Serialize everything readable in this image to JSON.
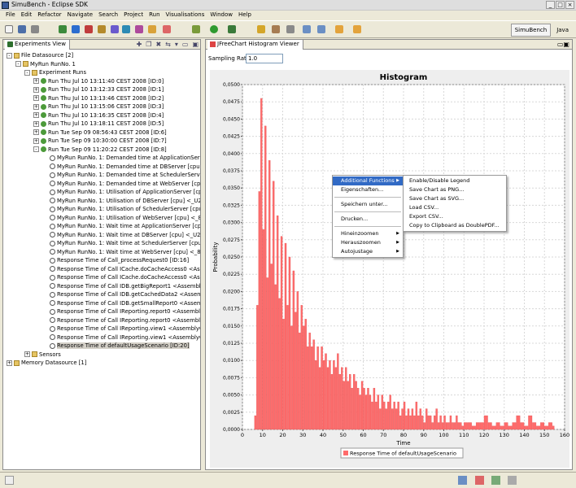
{
  "window": {
    "title": "SimuBench - Eclipse SDK",
    "controls": [
      "_",
      "□",
      "×"
    ]
  },
  "menubar": [
    "File",
    "Edit",
    "Refactor",
    "Navigate",
    "Search",
    "Project",
    "Run",
    "Visualisations",
    "Window",
    "Help"
  ],
  "perspectives": [
    {
      "label": "SimuBench",
      "active": true
    },
    {
      "label": "Java",
      "active": false
    }
  ],
  "experiments_view": {
    "tab": "Experiments View",
    "tree": [
      {
        "level": 0,
        "exp": "-",
        "icon": "folder",
        "text": "File Datasource [2]"
      },
      {
        "level": 1,
        "exp": "-",
        "icon": "folder",
        "text": "MyRun RunNo. 1"
      },
      {
        "level": 2,
        "exp": "-",
        "icon": "folder",
        "text": "Experiment Runs"
      },
      {
        "level": 3,
        "exp": "+",
        "icon": "run",
        "text": "Run Thu Jul 10 13:11:40 CEST 2008 [ID:0]"
      },
      {
        "level": 3,
        "exp": "+",
        "icon": "run",
        "text": "Run Thu Jul 10 13:12:33 CEST 2008 [ID:1]"
      },
      {
        "level": 3,
        "exp": "+",
        "icon": "run",
        "text": "Run Thu Jul 10 13:13:46 CEST 2008 [ID:2]"
      },
      {
        "level": 3,
        "exp": "+",
        "icon": "run",
        "text": "Run Thu Jul 10 13:15:06 CEST 2008 [ID:3]"
      },
      {
        "level": 3,
        "exp": "+",
        "icon": "run",
        "text": "Run Thu Jul 10 13:16:35 CEST 2008 [ID:4]"
      },
      {
        "level": 3,
        "exp": "+",
        "icon": "run",
        "text": "Run Thu Jul 10 13:18:11 CEST 2008 [ID:5]"
      },
      {
        "level": 3,
        "exp": "+",
        "icon": "run",
        "text": "Run Tue Sep 09 08:56:43 CEST 2008 [ID:6]"
      },
      {
        "level": 3,
        "exp": "+",
        "icon": "run",
        "text": "Run Tue Sep 09 10:30:00 CEST 2008 [ID:7]"
      },
      {
        "level": 3,
        "exp": "-",
        "icon": "run",
        "text": "Run Tue Sep 09 11:20:22 CEST 2008 [ID:8]"
      },
      {
        "level": 4,
        "exp": "",
        "icon": "sensor",
        "text": "MyRun RunNo. 1: Demanded time at ApplicationServer ["
      },
      {
        "level": 4,
        "exp": "",
        "icon": "sensor",
        "text": "MyRun RunNo. 1: Demanded time at DBServer [cpu] <_"
      },
      {
        "level": 4,
        "exp": "",
        "icon": "sensor",
        "text": "MyRun RunNo. 1: Demanded time at SchedulerServer [cp"
      },
      {
        "level": 4,
        "exp": "",
        "icon": "sensor",
        "text": "MyRun RunNo. 1: Demanded time at WebServer [cpu] <_"
      },
      {
        "level": 4,
        "exp": "",
        "icon": "sensor",
        "text": "MyRun RunNo. 1: Utilisation of ApplicationServer [cpu]"
      },
      {
        "level": 4,
        "exp": "",
        "icon": "sensor",
        "text": "MyRun RunNo. 1: Utilisation of DBServer [cpu] <_U2Nv"
      },
      {
        "level": 4,
        "exp": "",
        "icon": "sensor",
        "text": "MyRun RunNo. 1: Utilisation of SchedulerServer [cpu]"
      },
      {
        "level": 4,
        "exp": "",
        "icon": "sensor",
        "text": "MyRun RunNo. 1: Utilisation of WebServer [cpu] <_8-cp"
      },
      {
        "level": 4,
        "exp": "",
        "icon": "sensor",
        "text": "MyRun RunNo. 1: Wait time at ApplicationServer [cpu]"
      },
      {
        "level": 4,
        "exp": "",
        "icon": "sensor",
        "text": "MyRun RunNo. 1: Wait time at DBServer [cpu] <_U2Nv"
      },
      {
        "level": 4,
        "exp": "",
        "icon": "sensor",
        "text": "MyRun RunNo. 1: Wait time at SchedulerServer [cpu] <"
      },
      {
        "level": 4,
        "exp": "",
        "icon": "sensor",
        "text": "MyRun RunNo. 1: Wait time at WebServer [cpu] <_8-cp"
      },
      {
        "level": 4,
        "exp": "",
        "icon": "sensor",
        "text": "Response Time of Call_processRequest0 [ID:16]"
      },
      {
        "level": 4,
        "exp": "",
        "icon": "sensor",
        "text": "Response Time of Call ICache.doCacheAccess0 <Assem"
      },
      {
        "level": 4,
        "exp": "",
        "icon": "sensor",
        "text": "Response Time of Call ICache.doCacheAccess0 <Assem"
      },
      {
        "level": 4,
        "exp": "",
        "icon": "sensor",
        "text": "Response Time of Call IDB.getBigReport1 <AssemblyCt"
      },
      {
        "level": 4,
        "exp": "",
        "icon": "sensor",
        "text": "Response Time of Call IDB.getCachedData2 <Assembly"
      },
      {
        "level": 4,
        "exp": "",
        "icon": "sensor",
        "text": "Response Time of Call IDB.getSmallReport0 <Assembly"
      },
      {
        "level": 4,
        "exp": "",
        "icon": "sensor",
        "text": "Response Time of Call IReporting.report0 <AssemblyCt"
      },
      {
        "level": 4,
        "exp": "",
        "icon": "sensor",
        "text": "Response Time of Call IReporting.report0 <AssemblyCt"
      },
      {
        "level": 4,
        "exp": "",
        "icon": "sensor",
        "text": "Response Time of Call IReporting.view1 <AssemblyCtx:"
      },
      {
        "level": 4,
        "exp": "",
        "icon": "sensor",
        "text": "Response Time of Call IReporting.view1 <AssemblyCtx:"
      },
      {
        "level": 4,
        "exp": "",
        "icon": "sensor",
        "text": "Response Time of defaultUsageScenario [ID:20]",
        "selected": true
      },
      {
        "level": 2,
        "exp": "+",
        "icon": "folder",
        "text": "Sensors"
      },
      {
        "level": 0,
        "exp": "+",
        "icon": "folder",
        "text": "Memory Datasource [1]"
      }
    ]
  },
  "histogram_view": {
    "tab": "JFreeChart Histogram Viewer",
    "sampling_label": "Sampling Rate",
    "sampling_value": "1.0"
  },
  "context_menu": {
    "items": [
      {
        "label": "Additional Functions",
        "submenu": true,
        "highlight": true
      },
      {
        "label": "Eigenschaften..."
      },
      {
        "sep": true
      },
      {
        "label": "Speichern unter..."
      },
      {
        "sep": true
      },
      {
        "label": "Drucken..."
      },
      {
        "sep": true
      },
      {
        "label": "Hineinzoomen",
        "submenu": true
      },
      {
        "label": "Herauszoomen",
        "submenu": true
      },
      {
        "label": "Autojustage",
        "submenu": true
      }
    ],
    "submenu": [
      "Enable/Disable Legend",
      "Save Chart as PNG...",
      "Save Chart as SVG...",
      "Load CSV...",
      "Export CSV...",
      "Copy to Clipboard as DoublePDF..."
    ]
  },
  "chart_data": {
    "type": "bar",
    "title": "Histogram",
    "xlabel": "Time",
    "ylabel": "Probability",
    "xlim": [
      0,
      160
    ],
    "ylim": [
      0,
      0.05
    ],
    "xticks": [
      0,
      10,
      20,
      30,
      40,
      50,
      60,
      70,
      80,
      90,
      100,
      110,
      120,
      130,
      140,
      150,
      160
    ],
    "yticks": [
      "0,0000",
      "0,0025",
      "0,0050",
      "0,0075",
      "0,0100",
      "0,0125",
      "0,0150",
      "0,0175",
      "0,0200",
      "0,0225",
      "0,0250",
      "0,0275",
      "0,0300",
      "0,0325",
      "0,0350",
      "0,0375",
      "0,0400",
      "0,0425",
      "0,0450",
      "0,0475",
      "0,0500"
    ],
    "legend": {
      "placement": "bottom"
    },
    "series": [
      {
        "name": "Response Time of defaultUsageScenario",
        "color": "#ff6b6b",
        "x": [
          6,
          7,
          8,
          9,
          10,
          11,
          12,
          13,
          14,
          15,
          16,
          17,
          18,
          19,
          20,
          21,
          22,
          23,
          24,
          25,
          26,
          27,
          28,
          29,
          30,
          31,
          32,
          33,
          34,
          35,
          36,
          37,
          38,
          39,
          40,
          41,
          42,
          43,
          44,
          45,
          46,
          47,
          48,
          49,
          50,
          51,
          52,
          53,
          54,
          55,
          56,
          57,
          58,
          59,
          60,
          61,
          62,
          63,
          64,
          65,
          66,
          67,
          68,
          69,
          70,
          71,
          72,
          73,
          74,
          75,
          76,
          77,
          78,
          79,
          80,
          81,
          82,
          83,
          84,
          85,
          86,
          87,
          88,
          89,
          90,
          91,
          92,
          93,
          94,
          95,
          96,
          97,
          98,
          99,
          100,
          101,
          102,
          103,
          104,
          105,
          106,
          107,
          108,
          109,
          110,
          112,
          114,
          116,
          118,
          120,
          122,
          124,
          126,
          128,
          130,
          132,
          134,
          136,
          138,
          140,
          142,
          144,
          146,
          148,
          150,
          152,
          154
        ],
        "values": [
          0.002,
          0.018,
          0.0345,
          0.048,
          0.029,
          0.044,
          0.022,
          0.039,
          0.024,
          0.036,
          0.021,
          0.031,
          0.019,
          0.028,
          0.016,
          0.027,
          0.018,
          0.025,
          0.015,
          0.023,
          0.017,
          0.02,
          0.014,
          0.018,
          0.015,
          0.016,
          0.012,
          0.014,
          0.012,
          0.013,
          0.01,
          0.012,
          0.009,
          0.012,
          0.01,
          0.011,
          0.009,
          0.01,
          0.008,
          0.01,
          0.009,
          0.011,
          0.008,
          0.009,
          0.007,
          0.009,
          0.007,
          0.008,
          0.006,
          0.008,
          0.007,
          0.006,
          0.005,
          0.007,
          0.006,
          0.005,
          0.006,
          0.005,
          0.004,
          0.006,
          0.004,
          0.005,
          0.003,
          0.005,
          0.004,
          0.003,
          0.004,
          0.005,
          0.003,
          0.004,
          0.003,
          0.004,
          0.002,
          0.003,
          0.004,
          0.002,
          0.003,
          0.002,
          0.003,
          0.002,
          0.004,
          0.002,
          0.003,
          0.002,
          0.001,
          0.003,
          0.002,
          0.002,
          0.001,
          0.002,
          0.003,
          0.001,
          0.002,
          0.001,
          0.002,
          0.001,
          0.001,
          0.002,
          0.001,
          0.001,
          0.002,
          0.001,
          0.001,
          0.0005,
          0.001,
          0.001,
          0.0005,
          0.001,
          0.001,
          0.002,
          0.001,
          0.0005,
          0.001,
          0.0005,
          0.001,
          0.0005,
          0.001,
          0.002,
          0.001,
          0.0005,
          0.002,
          0.001,
          0.0005,
          0.001,
          0.0005,
          0.001,
          0.0005
        ]
      }
    ]
  }
}
